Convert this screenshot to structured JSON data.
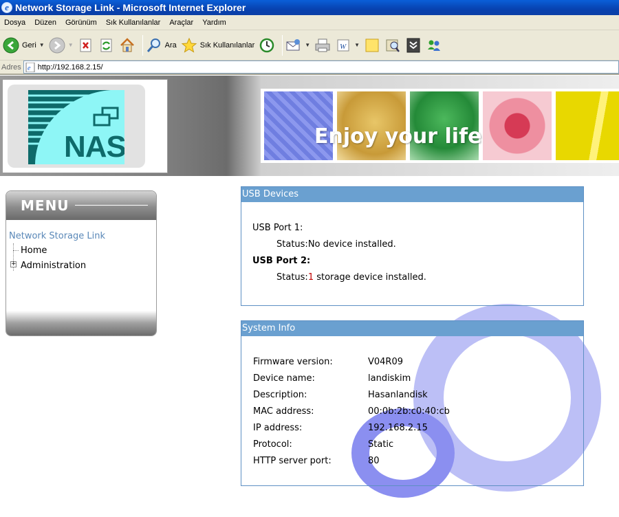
{
  "window": {
    "title": "Network Storage Link - Microsoft Internet Explorer"
  },
  "menubar": {
    "items": [
      "Dosya",
      "Düzen",
      "Görünüm",
      "Sık Kullanılanlar",
      "Araçlar",
      "Yardım"
    ]
  },
  "toolbar": {
    "back_label": "Geri",
    "search_label": "Ara",
    "favorites_label": "Sık Kullanılanlar"
  },
  "address": {
    "label": "Adres",
    "url": "http://192.168.2.15/"
  },
  "header": {
    "logo_text": "NAS",
    "banner_text": "Enjoy your life"
  },
  "menu": {
    "title": "MENU",
    "root": "Network Storage Link",
    "items": [
      "Home",
      "Administration"
    ]
  },
  "usb": {
    "title": "USB Devices",
    "port1_label": "USB Port 1:",
    "port1_status_label": "Status:",
    "port1_status": "No device installed.",
    "port2_label": "USB Port 2:",
    "port2_status_label": "Status:",
    "port2_count": "1",
    "port2_status": "storage device installed."
  },
  "system": {
    "title": "System Info",
    "rows": [
      {
        "label": "Firmware version:",
        "value": "V04R09"
      },
      {
        "label": "Device name:",
        "value": "landiskim"
      },
      {
        "label": "Description:",
        "value": "Hasanlandisk"
      },
      {
        "label": "MAC address:",
        "value": "00:0b:2b:c0:40:cb"
      },
      {
        "label": "IP address:",
        "value": "192.168.2.15"
      },
      {
        "label": "Protocol:",
        "value": "Static"
      },
      {
        "label": "HTTP server port:",
        "value": "80"
      }
    ]
  },
  "colors": {
    "panel_header": "#6aa0d0",
    "link": "#5a88b8",
    "highlight": "#c00000",
    "logo_panel": "#8ef6f6",
    "logo_ink": "#0e6a6a"
  }
}
